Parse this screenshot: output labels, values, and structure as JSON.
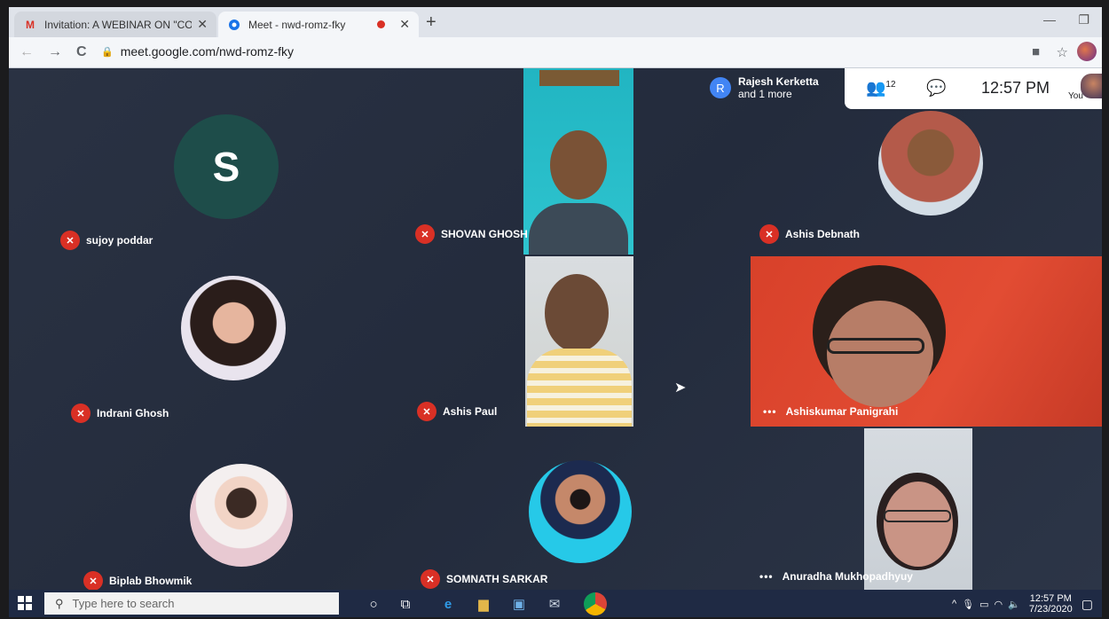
{
  "browser": {
    "tabs": [
      {
        "label": "Invitation: A WEBINAR ON \"CON",
        "icon": "gmail-icon",
        "active": false
      },
      {
        "label": "Meet - nwd-romz-fky",
        "icon": "meet-icon",
        "active": true,
        "recording": true
      }
    ],
    "url": "meet.google.com/nwd-romz-fky"
  },
  "meet": {
    "presenter": {
      "initial": "R",
      "name": "Rajesh Kerketta",
      "more": "and 1 more"
    },
    "participants_count": "12",
    "time": "12:57 PM",
    "self_label": "You",
    "tiles": [
      {
        "name": "sujoy poddar",
        "initial": "S",
        "muted": true
      },
      {
        "name": "SHOVAN GHOSH",
        "muted": true
      },
      {
        "name": "Ashis Debnath",
        "muted": true
      },
      {
        "name": "Indrani Ghosh",
        "muted": true
      },
      {
        "name": "Ashis Paul",
        "muted": true
      },
      {
        "name": "Ashiskumar Panigrahi",
        "muted": false
      },
      {
        "name": "Biplab Bhowmik",
        "muted": true
      },
      {
        "name": "SOMNATH SARKAR",
        "muted": true
      },
      {
        "name": "Anuradha Mukhopadhyuy",
        "muted": false
      }
    ]
  },
  "taskbar": {
    "search_placeholder": "Type here to search",
    "time": "12:57 PM",
    "date": "7/23/2020"
  },
  "colors": {
    "mute_red": "#d93025",
    "meet_bg": "#2a3243",
    "taskbar": "#1f2a44"
  }
}
